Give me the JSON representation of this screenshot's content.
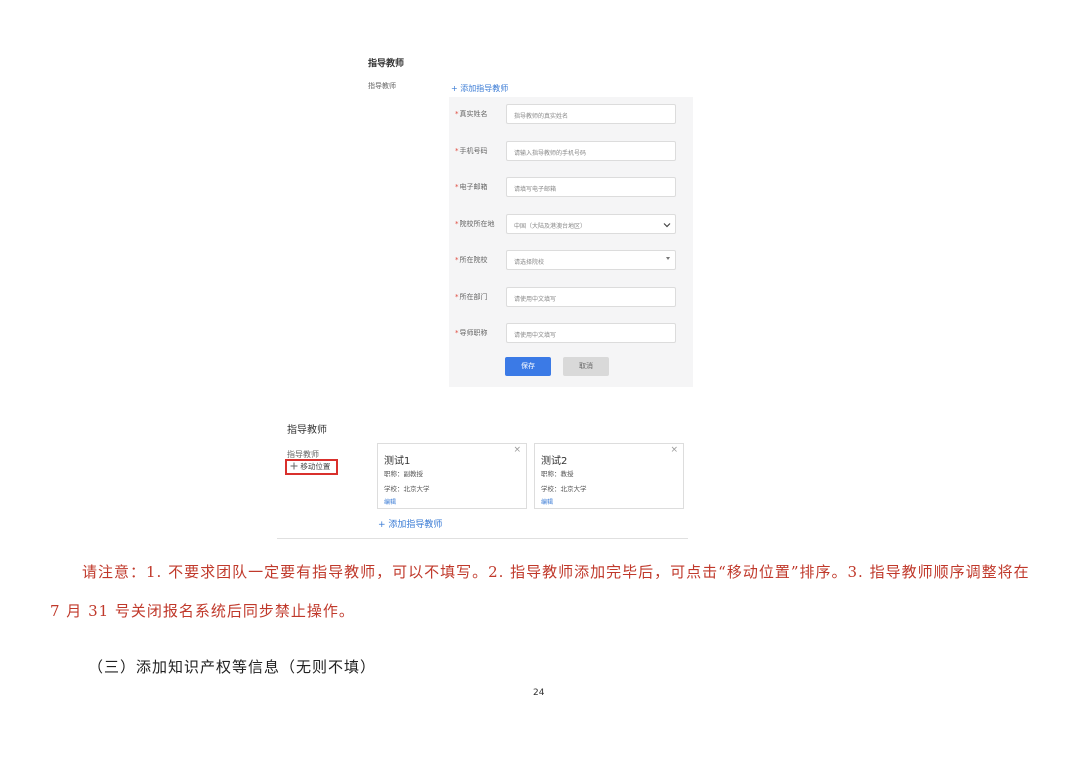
{
  "form_screenshot": {
    "section_title": "指导教师",
    "side_label": "指导教师",
    "add_link": "+ 添加指导教师",
    "fields": [
      {
        "label": "真实姓名",
        "placeholder": "指导教师的真实姓名"
      },
      {
        "label": "手机号码",
        "placeholder": "请输入指导教师的手机号码"
      },
      {
        "label": "电子邮箱",
        "placeholder": "请填写电子邮箱"
      },
      {
        "label": "院校所在地",
        "placeholder": "中国（大陆及港澳台地区）"
      },
      {
        "label": "所在院校",
        "placeholder": "请选择院校"
      },
      {
        "label": "所在部门",
        "placeholder": "请使用中文填写"
      },
      {
        "label": "导师职称",
        "placeholder": "请使用中文填写"
      }
    ],
    "save_label": "保存",
    "cancel_label": "取消"
  },
  "card_screenshot": {
    "section_title": "指导教师",
    "side_label": "指导教师",
    "move_label": "移动位置",
    "cards": [
      {
        "name": "测试1",
        "title_line": "职称：副教授",
        "school_line": "学校：北京大学",
        "edit": "编辑",
        "close": "×"
      },
      {
        "name": "测试2",
        "title_line": "职称：教授",
        "school_line": "学校：北京大学",
        "edit": "编辑",
        "close": "×"
      }
    ],
    "add_link": "+ 添加指导教师"
  },
  "note_text": "请注意：1. 不要求团队一定要有指导教师，可以不填写。2. 指导教师添加完毕后，可点击“移动位置”排序。3. 指导教师顺序调整将在 7 月 31 号关闭报名系统后同步禁止操作。",
  "section_heading": "（三）添加知识产权等信息（无则不填）",
  "page_number": "24"
}
